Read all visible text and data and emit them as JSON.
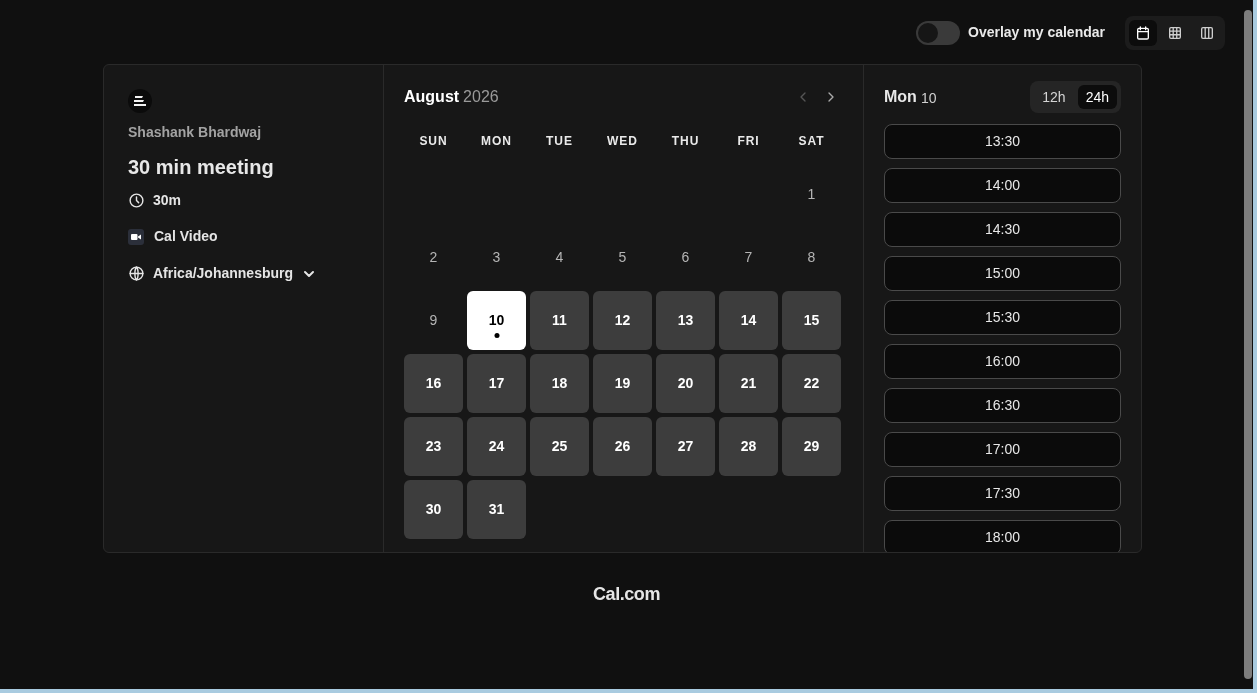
{
  "header": {
    "overlay_toggle": {
      "label": "Overlay my calendar",
      "on": false
    },
    "view_buttons": [
      {
        "kind": "month",
        "selected": true
      },
      {
        "kind": "week",
        "selected": false
      },
      {
        "kind": "column",
        "selected": false
      }
    ]
  },
  "event": {
    "host": "Shashank Bhardwaj",
    "title": "30 min meeting",
    "duration": "30m",
    "location": "Cal Video",
    "timezone": "Africa/Johannesburg"
  },
  "calendar": {
    "month": "August",
    "year": "2026",
    "weekdays": [
      "SUN",
      "MON",
      "TUE",
      "WED",
      "THU",
      "FRI",
      "SAT"
    ],
    "weeks": [
      [
        {
          "label": "1",
          "available": false
        }
      ],
      [
        {
          "label": "2",
          "available": false
        },
        {
          "label": "3",
          "available": false
        },
        {
          "label": "4",
          "available": false
        },
        {
          "label": "5",
          "available": false
        },
        {
          "label": "6",
          "available": false
        },
        {
          "label": "7",
          "available": false
        },
        {
          "label": "8",
          "available": false
        }
      ],
      [
        {
          "label": "9",
          "available": false
        },
        {
          "label": "10",
          "available": true,
          "selected": true
        },
        {
          "label": "11",
          "available": true,
          "selected": false
        },
        {
          "label": "12",
          "available": true,
          "selected": false
        },
        {
          "label": "13",
          "available": true,
          "selected": false
        },
        {
          "label": "14",
          "available": true,
          "selected": false
        },
        {
          "label": "15",
          "available": true,
          "selected": false
        }
      ],
      [
        {
          "label": "16",
          "available": true,
          "selected": false
        },
        {
          "label": "17",
          "available": true,
          "selected": false
        },
        {
          "label": "18",
          "available": true,
          "selected": false
        },
        {
          "label": "19",
          "available": true,
          "selected": false
        },
        {
          "label": "20",
          "available": true,
          "selected": false
        },
        {
          "label": "21",
          "available": true,
          "selected": false
        },
        {
          "label": "22",
          "available": true,
          "selected": false
        }
      ],
      [
        {
          "label": "23",
          "available": true,
          "selected": false
        },
        {
          "label": "24",
          "available": true,
          "selected": false
        },
        {
          "label": "25",
          "available": true,
          "selected": false
        },
        {
          "label": "26",
          "available": true,
          "selected": false
        },
        {
          "label": "27",
          "available": true,
          "selected": false
        },
        {
          "label": "28",
          "available": true,
          "selected": false
        },
        {
          "label": "29",
          "available": true,
          "selected": false
        }
      ],
      [
        {
          "label": "30",
          "available": true,
          "selected": false
        },
        {
          "label": "31",
          "available": true,
          "selected": false
        }
      ]
    ]
  },
  "slots": {
    "weekday": "Mon",
    "day": "10",
    "formats": [
      {
        "label": "12h",
        "selected": false
      },
      {
        "label": "24h",
        "selected": true
      }
    ],
    "times": [
      "13:30",
      "14:00",
      "14:30",
      "15:00",
      "15:30",
      "16:00",
      "16:30",
      "17:00",
      "17:30",
      "18:00"
    ]
  },
  "footer": {
    "brand": "Cal.com"
  }
}
